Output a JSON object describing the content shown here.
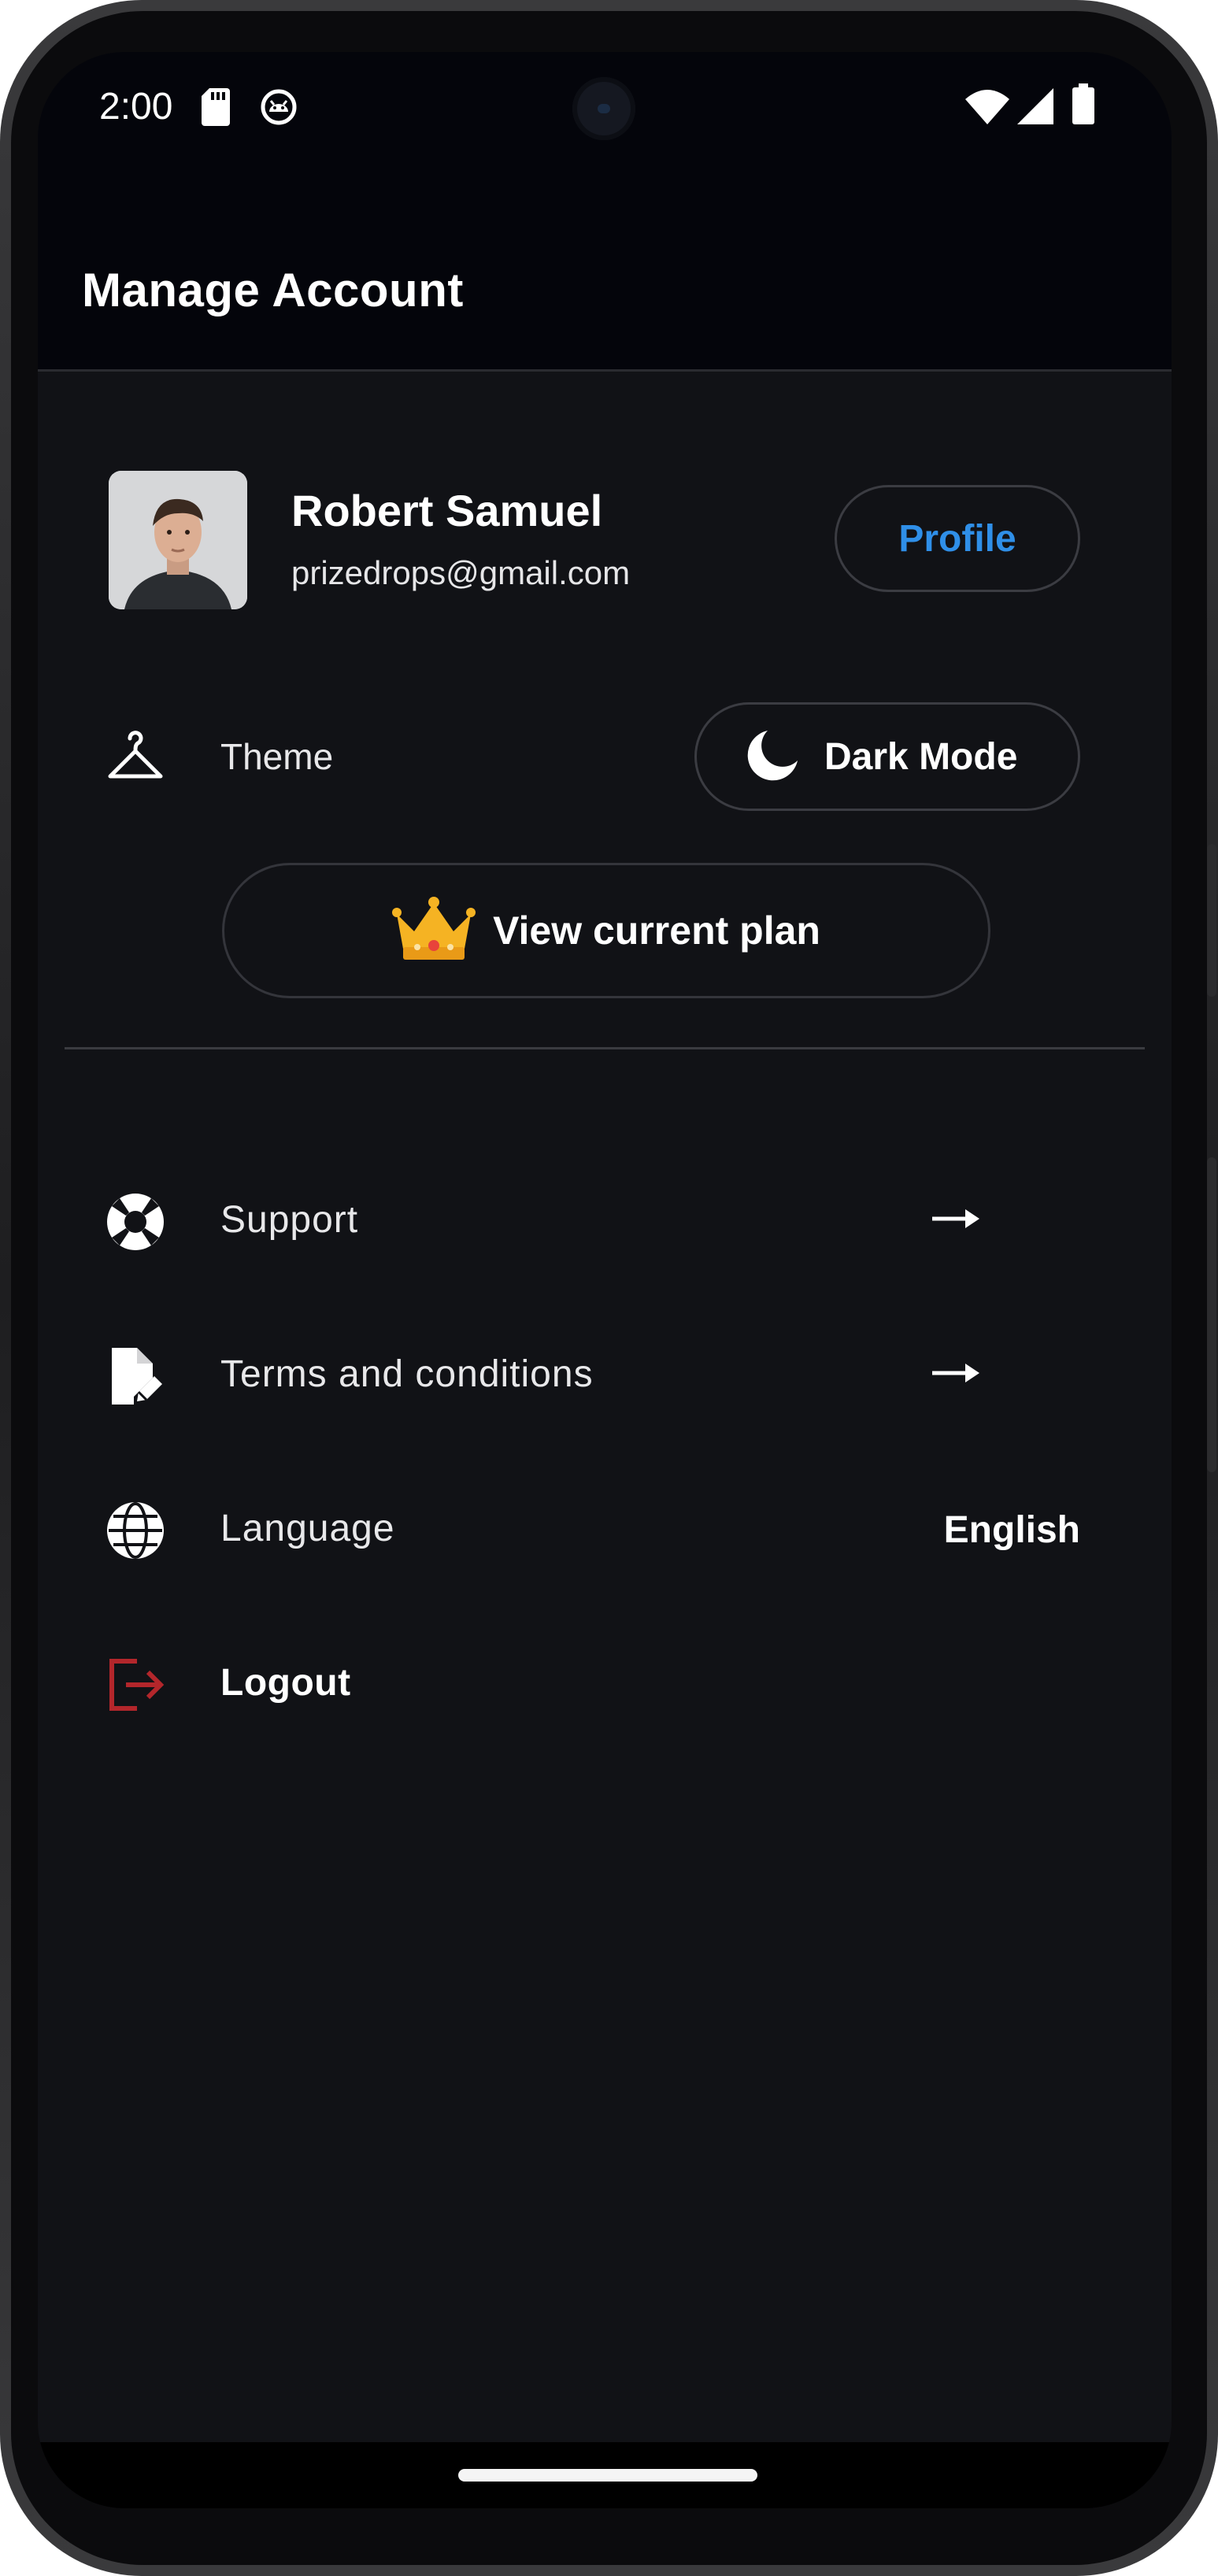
{
  "status_bar": {
    "time": "2:00",
    "left_icons": [
      "sd-card-icon",
      "android-debug-icon"
    ],
    "right_icons": [
      "wifi-icon",
      "cell-signal-icon",
      "battery-icon"
    ]
  },
  "app_bar": {
    "title": "Manage Account"
  },
  "profile": {
    "name": "Robert Samuel",
    "email": "prizedrops@gmail.com",
    "profile_button": "Profile",
    "avatar_icon": "user-photo"
  },
  "theme": {
    "label": "Theme",
    "icon": "hanger-icon",
    "mode_button": "Dark Mode",
    "mode_icon": "moon-icon"
  },
  "plan": {
    "button": "View current plan",
    "icon": "crown-icon"
  },
  "menu": [
    {
      "label": "Support",
      "icon": "lifebuoy-icon",
      "trailing": "arrow-right-icon"
    },
    {
      "label": "Terms and conditions",
      "icon": "document-edit-icon",
      "trailing": "arrow-right-icon"
    },
    {
      "label": "Language",
      "icon": "globe-icon",
      "value": "English"
    },
    {
      "label": "Logout",
      "icon": "logout-icon"
    }
  ],
  "colors": {
    "background": "#111216",
    "app_bar": "#04050b",
    "accent_blue": "#2f8fe8",
    "logout_red": "#b3262b",
    "crown_gold": "#f5b323"
  }
}
